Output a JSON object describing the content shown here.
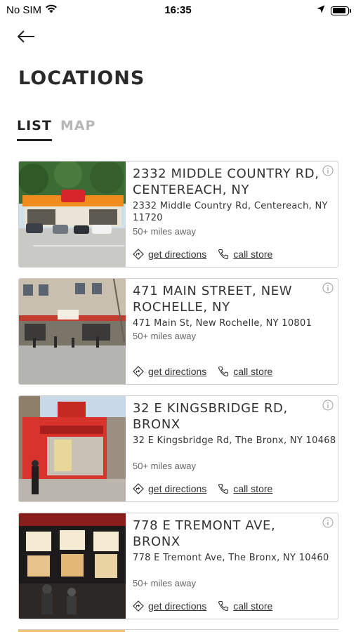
{
  "status_bar": {
    "carrier": "No SIM",
    "time": "16:35"
  },
  "header": {
    "title": "LOCATIONS"
  },
  "tabs": [
    {
      "label": "LIST",
      "active": true
    },
    {
      "label": "MAP",
      "active": false
    }
  ],
  "actions": {
    "directions_label": "get directions",
    "call_label": "call store"
  },
  "locations": [
    {
      "title": "2332 MIDDLE COUNTRY RD, CENTEREACH, NY",
      "address": "2332 Middle Country Rd, Centereach, NY 11720",
      "distance": "50+ miles away"
    },
    {
      "title": "471 MAIN STREET, NEW ROCHELLE, NY",
      "address": "471 Main St, New Rochelle, NY 10801",
      "distance": "50+ miles away"
    },
    {
      "title": "32 E KINGSBRIDGE RD, BRONX",
      "address": "32 E Kingsbridge Rd, The Bronx, NY 10468",
      "distance": "50+ miles away"
    },
    {
      "title": "778 E TREMONT AVE, BRONX",
      "address": "778 E Tremont Ave, The Bronx, NY 10460",
      "distance": "50+ miles away"
    }
  ],
  "colors": {
    "accent": "#222222",
    "inactive_tab": "#b7b7b7",
    "card_border": "#cfcfcf",
    "brand_orange": "#f08c1e",
    "brand_red": "#d6262b"
  }
}
